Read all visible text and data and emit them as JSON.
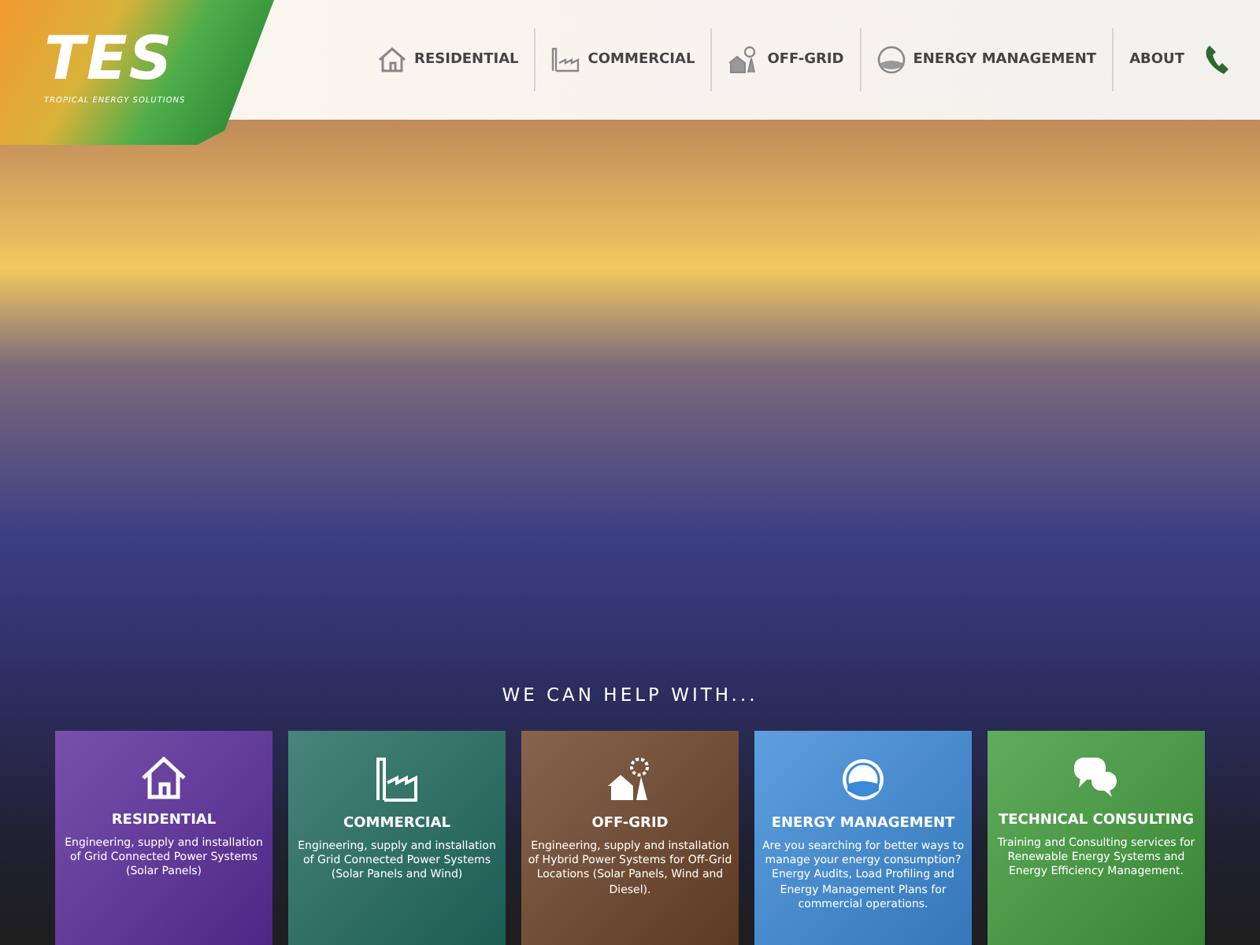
{
  "logo": {
    "mark": "TES",
    "tagline": "TROPICAL ENERGY SOLUTIONS"
  },
  "nav": [
    {
      "label": "RESIDENTIAL",
      "kind": "house"
    },
    {
      "label": "COMMERCIAL",
      "kind": "factory"
    },
    {
      "label": "OFF-GRID",
      "kind": "offgrid"
    },
    {
      "label": "ENERGY MANAGEMENT",
      "kind": "gauge"
    },
    {
      "label": "ABOUT",
      "kind": "none"
    }
  ],
  "heading": "WE CAN HELP WITH...",
  "services": [
    {
      "title": "RESIDENTIAL",
      "text": "Engineering, supply and installation of Grid Connected Power Systems (Solar Panels)",
      "kind": "house",
      "color": "#5a2a9a"
    },
    {
      "title": "COMMERCIAL",
      "text": "Engineering, supply and installation of Grid Connected Power Systems (Solar Panels and Wind)",
      "kind": "factory",
      "color": "#1f6a5e"
    },
    {
      "title": "OFF-GRID",
      "text": "Engineering, supply and installation of Hybrid Power Systems for Off-Grid Locations (Solar Panels, Wind and Diesel).",
      "kind": "offgrid",
      "color": "#6b4226"
    },
    {
      "title": "ENERGY MANAGEMENT",
      "text": "Are you searching for better ways to manage your energy consumption? Energy Audits, Load Profiling and Energy Management Plans for commercial operations.",
      "kind": "gauge",
      "color": "#3a8ad8"
    },
    {
      "title": "TECHNICAL CONSULTING",
      "text": "Training and Consulting services for Renewable Energy Systems and Energy Efficiency Management.",
      "kind": "chat",
      "color": "#3e9a3a"
    }
  ]
}
